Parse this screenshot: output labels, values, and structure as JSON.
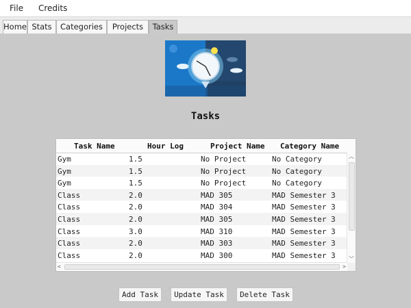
{
  "menu": {
    "file": "File",
    "credits": "Credits"
  },
  "tabs": [
    "Home",
    "Stats",
    "Categories",
    "Projects",
    "Tasks"
  ],
  "active_tab": "Tasks",
  "page": {
    "title": "Tasks"
  },
  "table": {
    "columns": [
      "Task Name",
      "Hour Log",
      "Project Name",
      "Category Name"
    ],
    "rows": [
      [
        "Gym",
        "1.5",
        "No Project",
        "No Category"
      ],
      [
        "Gym",
        "1.5",
        "No Project",
        "No Category"
      ],
      [
        "Gym",
        "1.5",
        "No Project",
        "No Category"
      ],
      [
        "Class",
        "2.0",
        "MAD 305",
        "MAD Semester 3"
      ],
      [
        "Class",
        "2.0",
        "MAD 304",
        "MAD Semester 3"
      ],
      [
        "Class",
        "2.0",
        "MAD 305",
        "MAD Semester 3"
      ],
      [
        "Class",
        "3.0",
        "MAD 310",
        "MAD Semester 3"
      ],
      [
        "Class",
        "2.0",
        "MAD 303",
        "MAD Semester 3"
      ],
      [
        "Class",
        "2.0",
        "MAD 300",
        "MAD Semester 3"
      ]
    ]
  },
  "buttons": {
    "add": "Add Task",
    "update": "Update Task",
    "delete": "Delete Task"
  },
  "icons": {
    "logo": "clock-logo-icon"
  },
  "colors": {
    "logo_left": "#1b78c8",
    "logo_right": "#23476e",
    "sun": "#ffe14d"
  }
}
